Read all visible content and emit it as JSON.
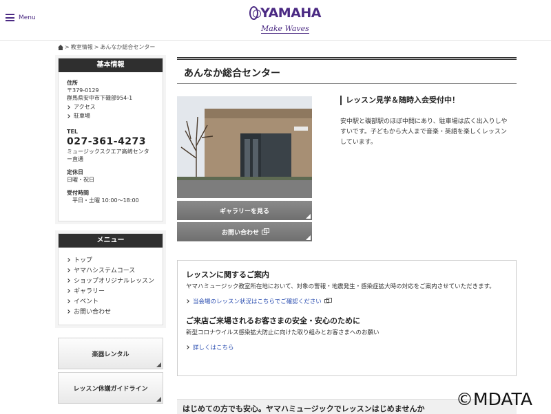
{
  "header": {
    "menu_label": "Menu",
    "brand_name": "YAMAHA",
    "brand_tagline": "Make Waves"
  },
  "breadcrumb": [
    {
      "label": "教室情報"
    },
    {
      "label": "あんなか総合センター"
    }
  ],
  "sidebar": {
    "info": {
      "heading": "基本情報",
      "address_label": "住所",
      "postal": "〒379-0129",
      "address": "群馬県安中市下磯部954-1",
      "access_link": "アクセス",
      "parking_link": "駐車場",
      "tel_label": "TEL",
      "tel": "027-361-4273",
      "tel_note": "ミュージックスクエア高崎センター直通",
      "closed_label": "定休日",
      "closed": "日曜・祝日",
      "hours_label": "受付時間",
      "hours": "平日・土曜 10:00〜18:00"
    },
    "menu": {
      "heading": "メニュー",
      "items": [
        {
          "label": "トップ"
        },
        {
          "label": "ヤマハシステムコース"
        },
        {
          "label": "ショップオリジナルレッスン"
        },
        {
          "label": "ギャラリー"
        },
        {
          "label": "イベント"
        },
        {
          "label": "お問い合わせ"
        }
      ]
    },
    "rental_button": "楽器レンタル",
    "guideline_button": "レッスン休講ガイドライン"
  },
  "main": {
    "title": "あんなか総合センター",
    "gallery_button": "ギャラリーを見る",
    "contact_button": "お問い合わせ",
    "promo_heading": "レッスン見学＆随時入会受付中！",
    "promo_text": "安中駅と磯部駅のほぼ中間にあり、駐車場は広く出入りしやすいです。子どもから大人まで音楽・英語を楽しくレッスンしています。",
    "notice": {
      "heading1": "レッスンに関するご案内",
      "text1": "ヤマハミュージック教室所在地において、対象の警報・地震発生・感染症拡大時の対応をご案内させていただきます。",
      "link1": "当会場のレッスン状況はこちらでご確認ください",
      "heading2": "ご来店ご来場されるお客さまの安全・安心のために",
      "text2": "新型コロナウイルス感染拡大防止に向けた取り組みとお客さまへのお願い",
      "link2": "詳しくはこちら"
    },
    "bottom_banner": "はじめての方でも安心。ヤマハミュージックでレッスンはじめませんか"
  },
  "watermark": "©MDATA",
  "colors": {
    "brand": "#4b2a83",
    "sidebar_header": "#2f2f2f",
    "gray_button": "#7a7a7a",
    "link": "#2a4db0"
  }
}
